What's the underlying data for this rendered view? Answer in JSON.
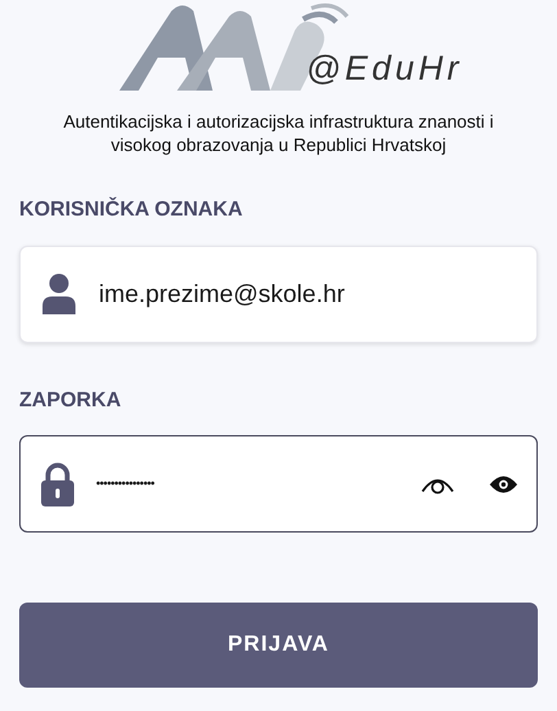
{
  "logo": {
    "text": "@EduHr"
  },
  "description": "Autentikacijska i autorizacijska infrastruktura znanosti i visokog obrazovanja u Republici Hrvatskoj",
  "username": {
    "label": "KORISNIČKA OZNAKA",
    "value": "ime.prezime@skole.hr",
    "focused": false
  },
  "password": {
    "label": "ZAPORKA",
    "value": "••••••••••••••••",
    "focused": true
  },
  "submit": {
    "label": "PRIJAVA"
  }
}
